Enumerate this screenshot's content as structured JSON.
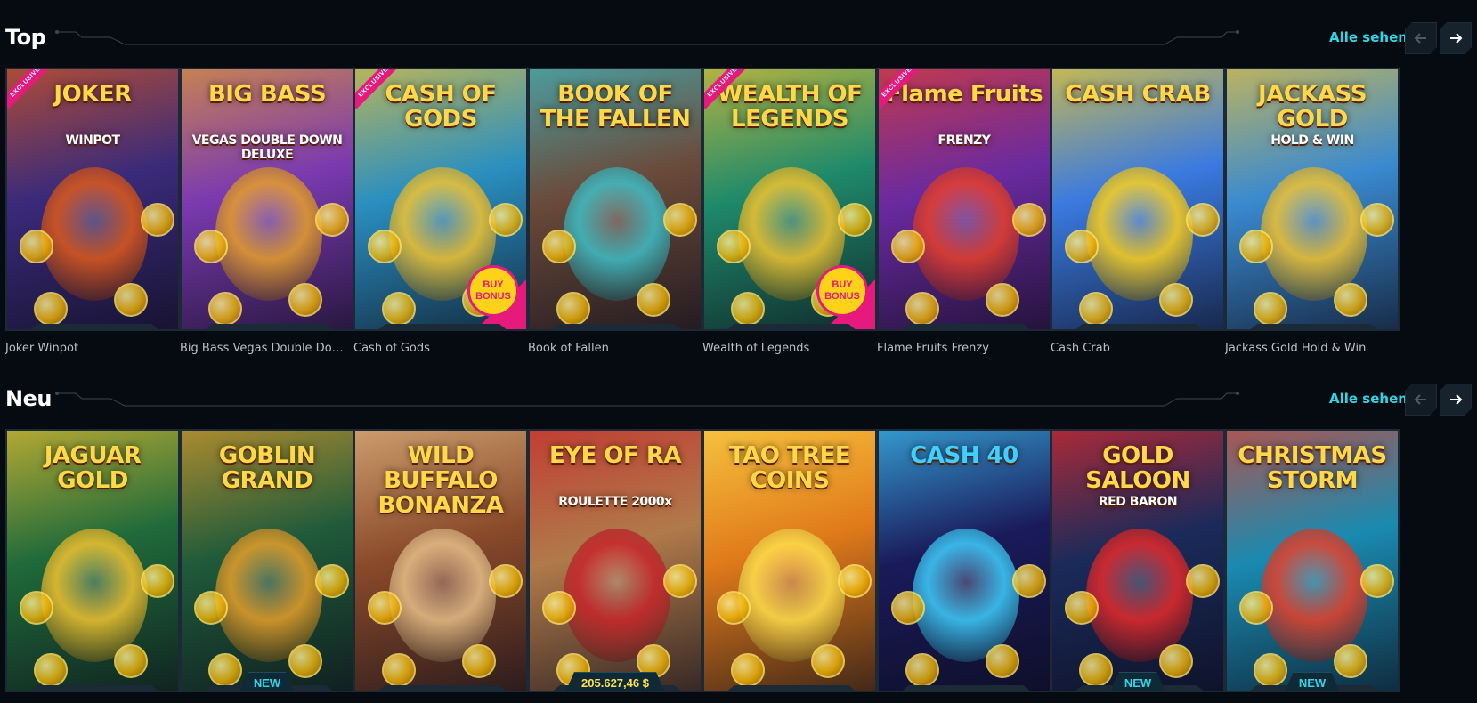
{
  "sections": {
    "top": {
      "title": "Top",
      "see_all": "Alle sehen",
      "games": [
        {
          "name": "Joker Winpot",
          "art_title": "JOKER",
          "art_sub": "WINPOT",
          "exclusive": "EXCLUSIVE",
          "bg": "#3a2a7a",
          "accent": "#e05a1a"
        },
        {
          "name": "Big Bass Vegas Double Down Del...",
          "art_title": "BIG BASS",
          "art_sub": "VEGAS DOUBLE DOWN DELUXE",
          "bg": "#7a3ab0",
          "accent": "#e8a02a"
        },
        {
          "name": "Cash of Gods",
          "art_title": "CASH OF GODS",
          "exclusive": "EXCLUSIVE",
          "buy_bonus": "BUY BONUS",
          "bg": "#2a8fc0",
          "accent": "#f4c430"
        },
        {
          "name": "Book of Fallen",
          "art_title": "BOOK OF THE FALLEN",
          "bg": "#6a4a3a",
          "accent": "#3fc0c8"
        },
        {
          "name": "Wealth of Legends",
          "art_title": "WEALTH OF LEGENDS",
          "exclusive": "EXCLUSIVE",
          "buy_bonus": "BUY BONUS",
          "bg": "#1f8a6a",
          "accent": "#f4c430"
        },
        {
          "name": "Flame Fruits Frenzy",
          "art_title": "Flame Fruits",
          "art_sub": "FRENZY",
          "exclusive": "EXCLUSIVE",
          "bg": "#6a2aa0",
          "accent": "#e8402a"
        },
        {
          "name": "Cash Crab",
          "art_title": "CASH CRAB",
          "bg": "#3a7ae0",
          "accent": "#ffd21a"
        },
        {
          "name": "Jackass Gold Hold & Win",
          "art_title": "JACKASS GOLD",
          "art_sub": "HOLD & WIN",
          "bg": "#3a8ad0",
          "accent": "#f4c430"
        }
      ]
    },
    "new": {
      "title": "Neu",
      "see_all": "Alle sehen",
      "games": [
        {
          "art_title": "JAGUAR GOLD",
          "bg": "#1f6a3a",
          "accent": "#f4c430"
        },
        {
          "art_title": "GOBLIN GRAND",
          "badge": "NEW",
          "bg": "#1f5a3a",
          "accent": "#e8a02a"
        },
        {
          "art_title": "WILD BUFFALO BONANZA",
          "bg": "#8a4a2a",
          "accent": "#e8c08a"
        },
        {
          "art_title": "EYE OF RA",
          "art_sub": "ROULETTE 2000x",
          "amount": "205.627,46 $",
          "bg": "#b07a4a",
          "accent": "#c8242a"
        },
        {
          "art_title": "TAO TREE COINS",
          "bg": "#e07a1a",
          "accent": "#ffe04d"
        },
        {
          "art_title": "CASH 40",
          "bg": "#1a1a5a",
          "accent": "#3fd0ff"
        },
        {
          "art_title": "GOLD SALOON",
          "art_sub": "RED BARON",
          "badge": "NEW",
          "bg": "#1a2a5a",
          "accent": "#e82a2a"
        },
        {
          "art_title": "CHRISTMAS STORM",
          "badge": "NEW",
          "bg": "#1a8ab0",
          "accent": "#e8402a"
        }
      ]
    }
  },
  "colors": {
    "accent": "#2fd6e6",
    "background": "#050b10",
    "exclusive": "#e6197d",
    "amount": "#ffe04d"
  },
  "icons": {
    "prev": "arrow-left-icon",
    "next": "arrow-right-icon"
  }
}
